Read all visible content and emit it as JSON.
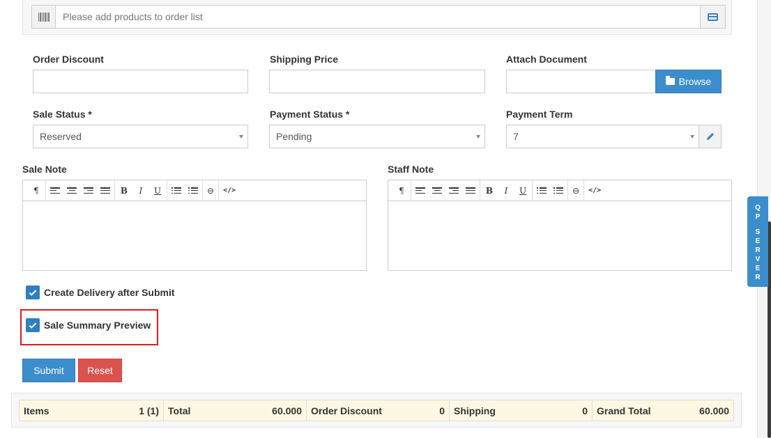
{
  "product_search": {
    "placeholder": "Please add products to order list"
  },
  "fields": {
    "order_discount": {
      "label": "Order Discount",
      "value": ""
    },
    "shipping_price": {
      "label": "Shipping Price",
      "value": ""
    },
    "attach_document": {
      "label": "Attach Document",
      "value": "",
      "browse_label": "Browse"
    },
    "sale_status": {
      "label": "Sale Status *",
      "value": "Reserved"
    },
    "payment_status": {
      "label": "Payment Status *",
      "value": "Pending"
    },
    "payment_term": {
      "label": "Payment Term",
      "value": "7"
    }
  },
  "editors": {
    "sale_note": {
      "label": "Sale Note"
    },
    "staff_note": {
      "label": "Staff Note"
    },
    "toolbar": {
      "paragraph": "¶",
      "bold": "B",
      "italic": "I",
      "underline": "U",
      "code": "</>",
      "link": "⊖"
    }
  },
  "checkboxes": {
    "create_delivery": {
      "label": "Create Delivery after Submit",
      "checked": true
    },
    "sale_summary_preview": {
      "label": "Sale Summary Preview",
      "checked": true
    }
  },
  "buttons": {
    "submit": "Submit",
    "reset": "Reset"
  },
  "totals": {
    "items_label": "Items",
    "items_value": "1 (1)",
    "total_label": "Total",
    "total_value": "60.000",
    "order_discount_label": "Order Discount",
    "order_discount_value": "0",
    "shipping_label": "Shipping",
    "shipping_value": "0",
    "grand_total_label": "Grand Total",
    "grand_total_value": "60.000"
  },
  "side_tab": {
    "line1": [
      "Q",
      "P"
    ],
    "line2": [
      "S",
      "E",
      "R",
      "V",
      "E",
      "R"
    ]
  },
  "colors": {
    "primary": "#3c8dcb",
    "danger": "#d9534f",
    "highlight": "#e01b1b",
    "totals_bg": "#fcf8e3"
  },
  "icons": {
    "barcode": "barcode-icon",
    "card": "credit-card-icon",
    "folder": "folder-open-icon",
    "pencil": "pencil-icon",
    "check": "checkmark-icon"
  }
}
